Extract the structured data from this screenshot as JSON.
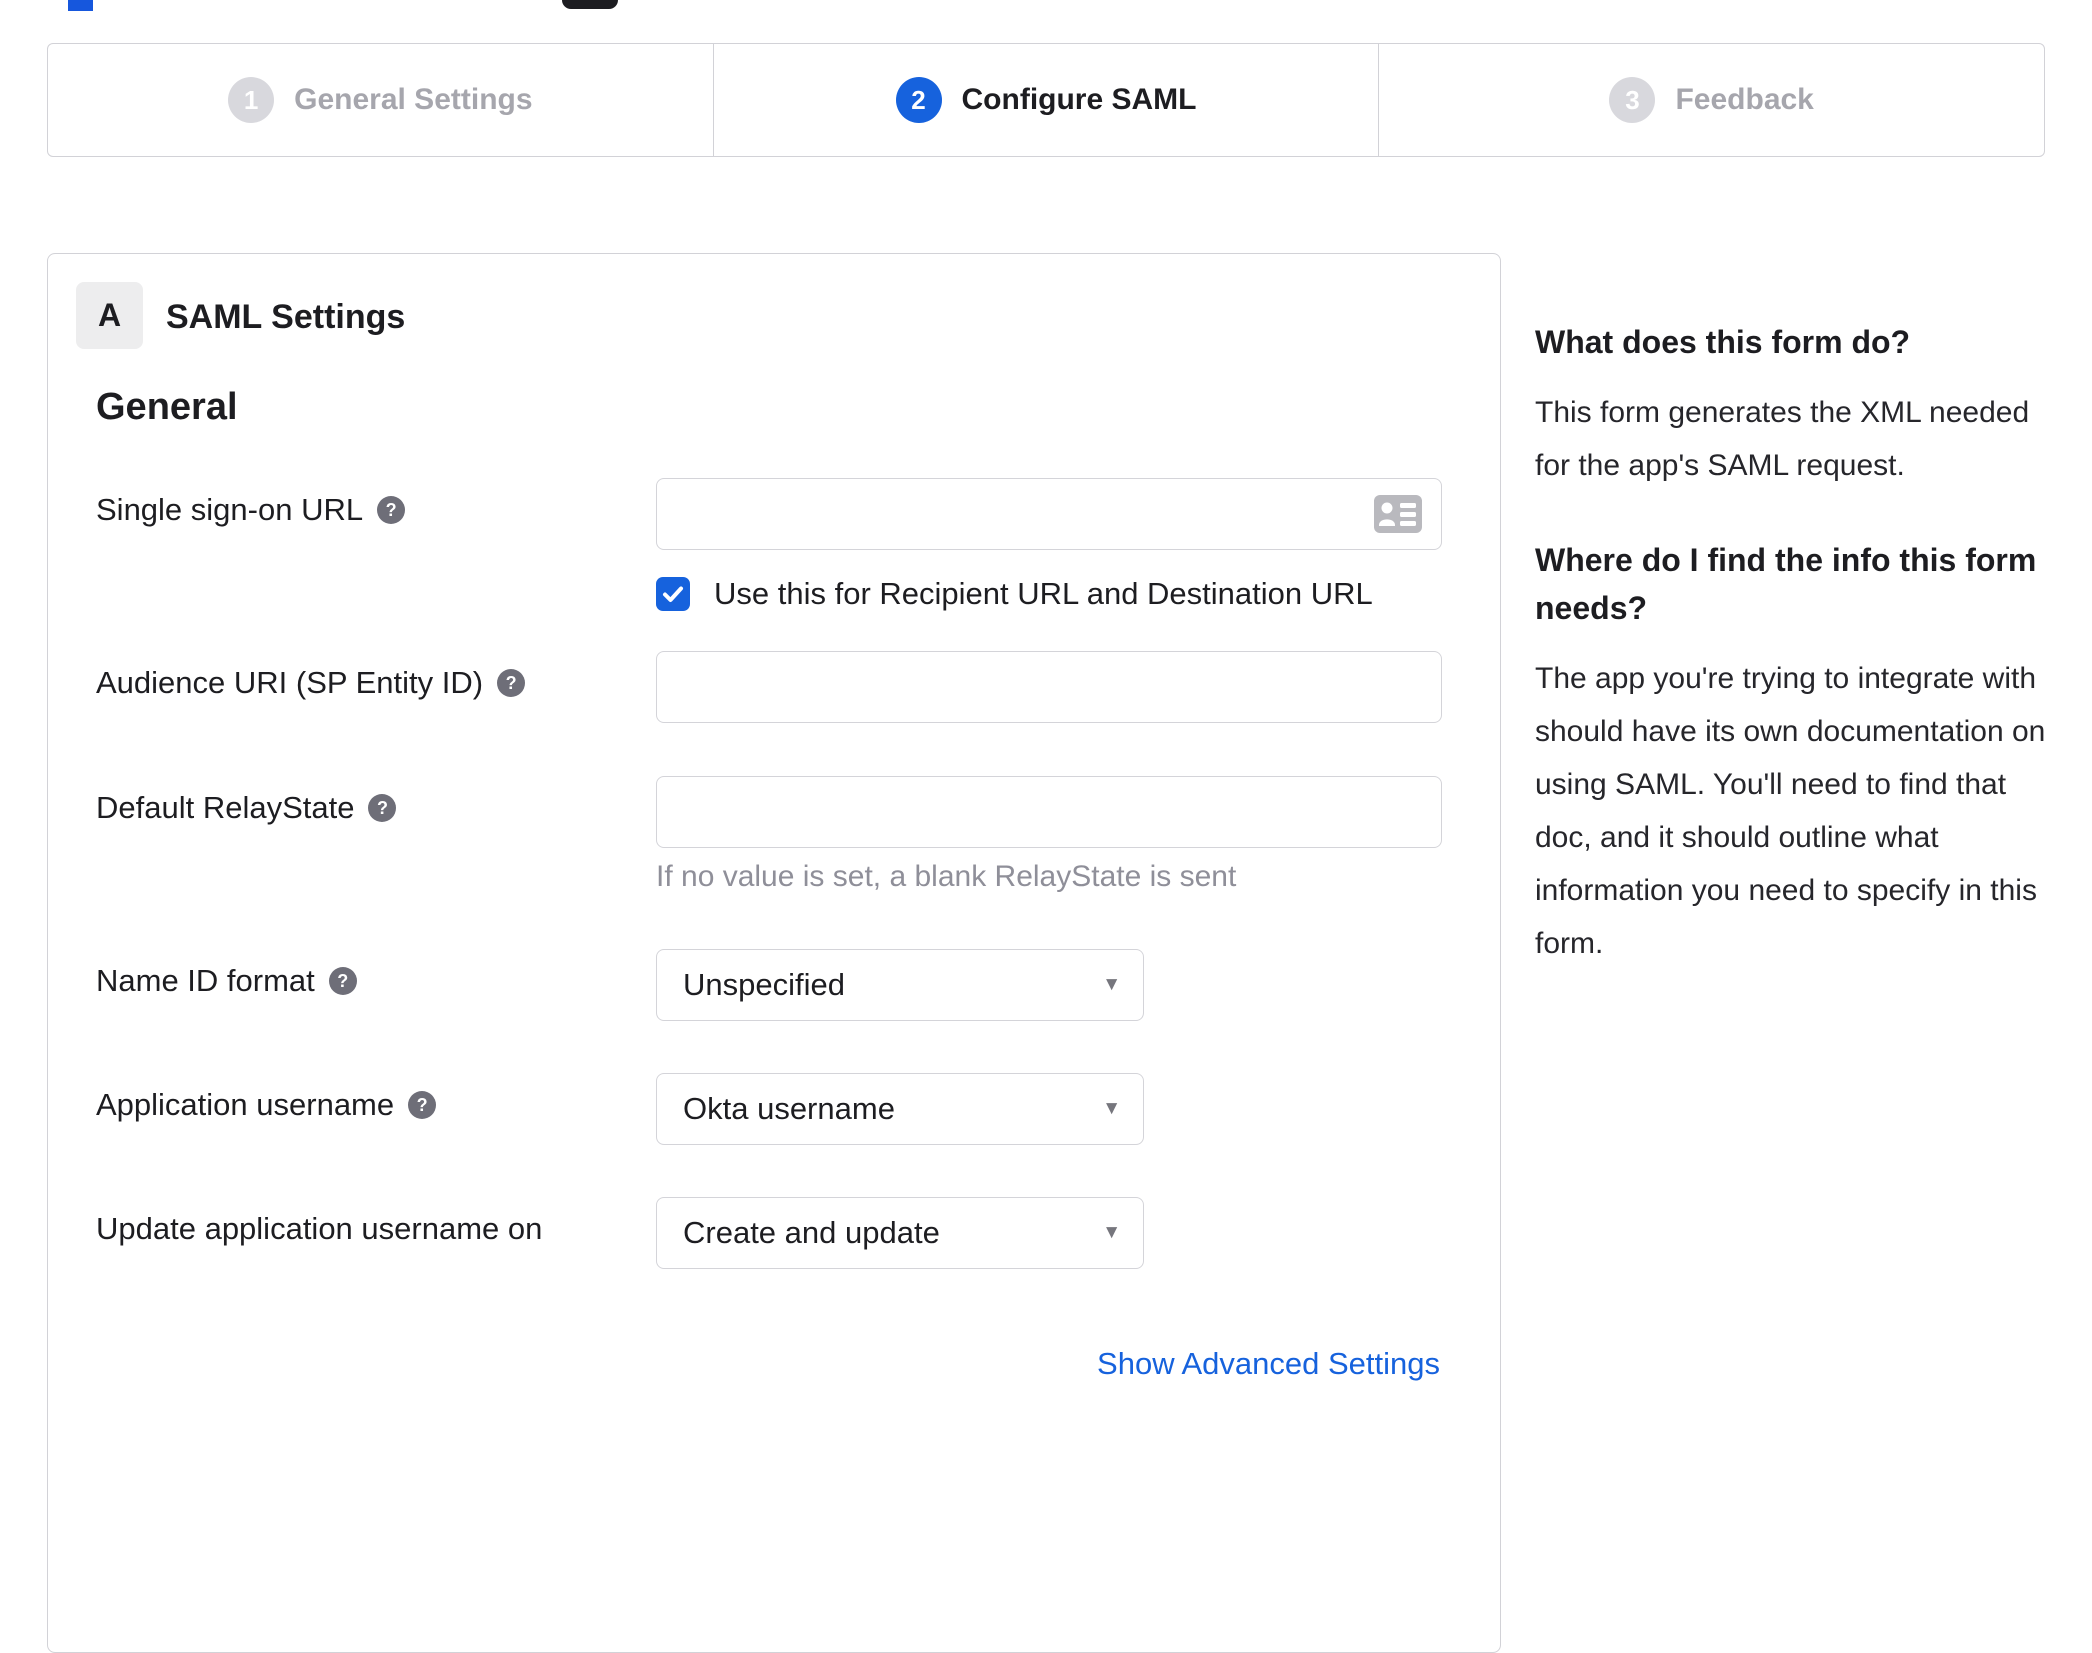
{
  "stepper": {
    "steps": [
      {
        "number": "1",
        "label": "General Settings",
        "state": "inactive"
      },
      {
        "number": "2",
        "label": "Configure SAML",
        "state": "active"
      },
      {
        "number": "3",
        "label": "Feedback",
        "state": "inactive"
      }
    ]
  },
  "panel": {
    "section_badge": "A",
    "section_title": "SAML Settings",
    "group_heading": "General"
  },
  "form": {
    "rows": [
      {
        "label": "Single sign-on URL",
        "has_help": true,
        "type": "text",
        "value": ""
      },
      {
        "label": "Audience URI (SP Entity ID)",
        "has_help": true,
        "type": "text",
        "value": ""
      },
      {
        "label": "Default RelayState",
        "has_help": true,
        "type": "text",
        "value": ""
      },
      {
        "label": "Name ID format",
        "has_help": true,
        "type": "select",
        "value": "Unspecified"
      },
      {
        "label": "Application username",
        "has_help": true,
        "type": "select",
        "value": "Okta username"
      },
      {
        "label": "Update application username on",
        "has_help": false,
        "type": "select",
        "value": "Create and update"
      }
    ],
    "sso_checkbox": {
      "checked": true,
      "label": "Use this for Recipient URL and Destination URL"
    },
    "relaystate_hint": "If no value is set, a blank RelayState is sent",
    "advanced_link": "Show Advanced Settings"
  },
  "sidebar": {
    "sections": [
      {
        "heading": "What does this form do?",
        "body": "This form generates the XML needed for the app's SAML request."
      },
      {
        "heading": "Where do I find the info this form needs?",
        "body": "The app you're trying to integrate with should have its own documentation on using SAML. You'll need to find that doc, and it should outline what information you need to specify in this form."
      }
    ]
  },
  "icons": {
    "help_glyph": "?",
    "caret_glyph": "▼",
    "help": "question-mark-circle-icon",
    "caret": "caret-down-icon",
    "checkbox": "checkmark-icon",
    "sso_field": "contact-card-icon"
  },
  "colors": {
    "accent_blue": "#1662dd",
    "inactive_step_gray": "#d8d8dd",
    "inactive_text_gray": "#a6a6ad",
    "border_gray": "#d2d2d7",
    "helper_text_gray": "#8f8f99",
    "help_icon_gray": "#6e6e78"
  }
}
